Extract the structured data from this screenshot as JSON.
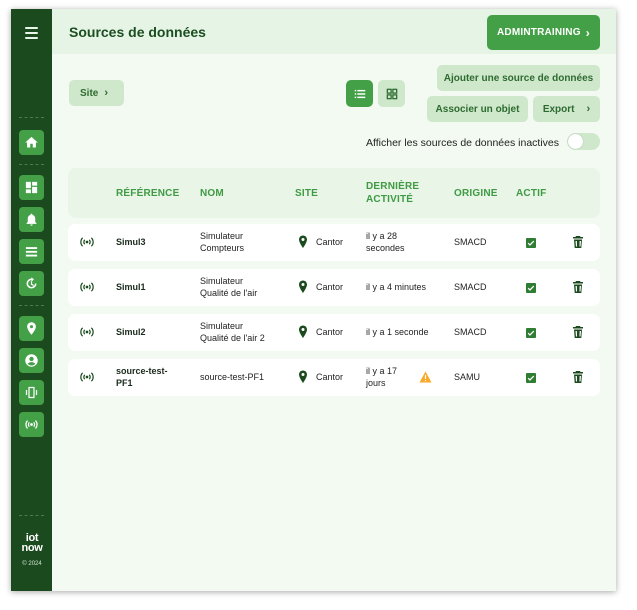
{
  "app": {
    "logo_line1": "iot",
    "logo_line2": "now",
    "copyright": "© 2024"
  },
  "sidebar": {
    "items": [
      {
        "icon": "home-icon"
      },
      {
        "icon": "dashboard-icon"
      },
      {
        "icon": "bell-icon"
      },
      {
        "icon": "list-icon"
      },
      {
        "icon": "history-icon"
      },
      {
        "icon": "location-pin-icon"
      },
      {
        "icon": "account-icon"
      },
      {
        "icon": "device-vibrate-icon"
      },
      {
        "icon": "signal-icon"
      }
    ]
  },
  "header": {
    "title": "Sources de données",
    "user_label": "ADMINTRAINING"
  },
  "toolbar": {
    "site_label": "Site",
    "add_label": "Ajouter une source de données",
    "associate_label": "Associer un objet",
    "export_label": "Export",
    "inactive_toggle_label": "Afficher les sources de données inactives",
    "inactive_toggle_on": false
  },
  "table": {
    "columns": {
      "reference": "RÉFÉRENCE",
      "name": "NOM",
      "site": "SITE",
      "last_activity_1": "DERNIÈRE",
      "last_activity_2": "ACTIVITÉ",
      "origin": "ORIGINE",
      "active": "ACTIF"
    },
    "rows": [
      {
        "reference": "Simul3",
        "name_1": "Simulateur",
        "name_2": "Compteurs",
        "site": "Cantor",
        "activity_1": "il y a 28",
        "activity_2": "secondes",
        "warning": false,
        "origin": "SMACD",
        "active": true
      },
      {
        "reference": "Simul1",
        "name_1": "Simulateur",
        "name_2": "Qualité de l'air",
        "site": "Cantor",
        "activity_1": "il y a 4 minutes",
        "activity_2": "",
        "warning": false,
        "origin": "SMACD",
        "active": true
      },
      {
        "reference": "Simul2",
        "name_1": "Simulateur",
        "name_2": "Qualité de l'air 2",
        "site": "Cantor",
        "activity_1": "il y a 1 seconde",
        "activity_2": "",
        "warning": false,
        "origin": "SMACD",
        "active": true
      },
      {
        "reference_1": "source-test-",
        "reference_2": "PF1",
        "name_1": "source-test-PF1",
        "name_2": "",
        "site": "Cantor",
        "activity_1": "il y a 17",
        "activity_2": "jours",
        "warning": true,
        "origin": "SAMU",
        "active": true
      }
    ]
  },
  "colors": {
    "sidebar": "#1c4a1f",
    "accent": "#43a047",
    "chip": "#cfe8cc",
    "warning": "#f9a825"
  }
}
